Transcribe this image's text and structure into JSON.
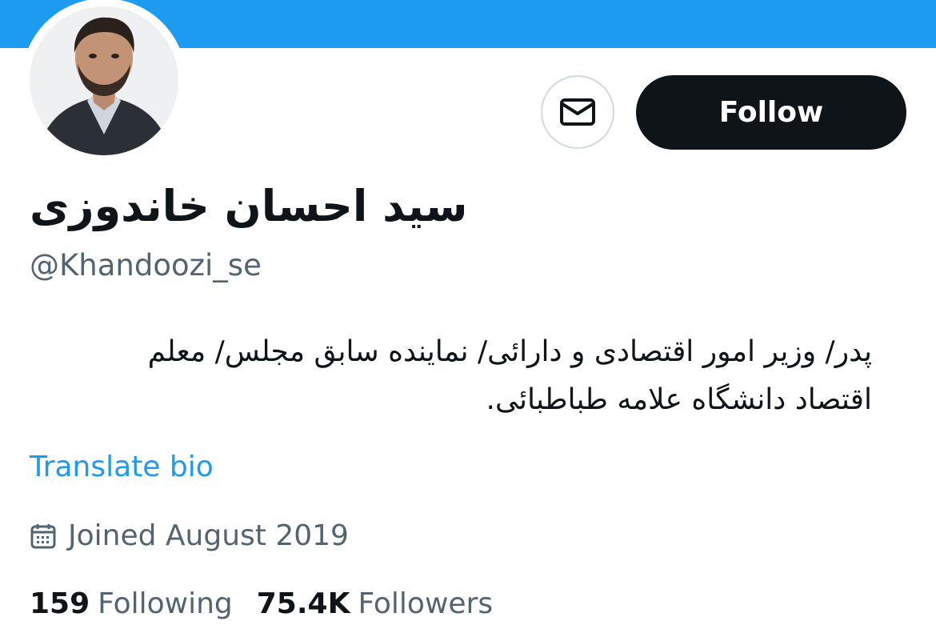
{
  "colors": {
    "banner": "#1d9bf0",
    "primary_text": "#0f1419",
    "secondary_text": "#536471",
    "link": "#1d9bf0",
    "follow_bg": "#0f1419"
  },
  "profile": {
    "display_name": "سید احسان خاندوزی",
    "handle": "@Khandoozi_se",
    "bio_line1": "پدر/ وزیر امور اقتصادی و دارائی/ نماینده سابق مجلس/ معلم",
    "bio_line2": "اقتصاد دانشگاه علامه طباطبائی.",
    "translate_label": "Translate bio",
    "joined": "Joined August 2019",
    "avatar_icon": "profile-photo"
  },
  "actions": {
    "message_icon": "envelope-icon",
    "follow_label": "Follow"
  },
  "stats": {
    "following_count": "159",
    "following_label": "Following",
    "followers_count": "75.4K",
    "followers_label": "Followers"
  }
}
